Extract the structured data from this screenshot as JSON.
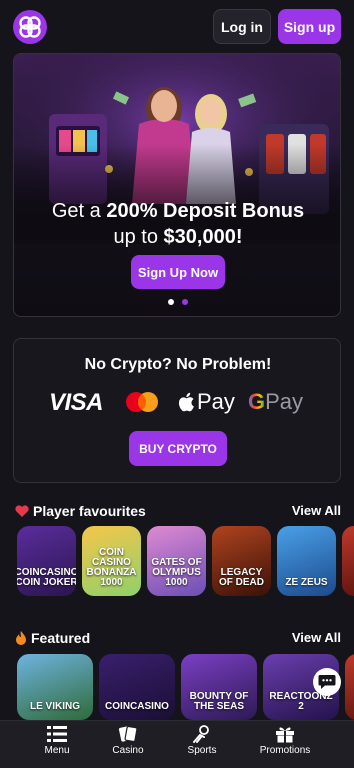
{
  "header": {
    "logo_icon": "coincasino-logo-icon",
    "login_label": "Log in",
    "signup_label": "Sign up"
  },
  "hero": {
    "title_prefix": "Get a ",
    "title_bold": "200% Deposit Bonus",
    "sub_prefix": "up to ",
    "sub_bold": "$30,000!",
    "cta_label": "Sign Up Now",
    "slides": 2,
    "active_slide": 1
  },
  "crypto": {
    "title": "No Crypto? No Problem!",
    "methods": [
      "VISA",
      "Mastercard",
      "Apple Pay",
      "Google Pay"
    ],
    "visa_text": "VISA",
    "applepay_text": "Pay",
    "gpay_g": "G",
    "gpay_text": "Pay",
    "buy_label": "BUY CRYPTO"
  },
  "favourites": {
    "title": "Player favourites",
    "icon": "heart-icon",
    "view_all": "View All",
    "games": [
      {
        "label": "COINCASINO COIN JOKER",
        "colors": [
          "#5a2d9c",
          "#2a1650"
        ]
      },
      {
        "label": "COIN CASINO BONANZA 1000",
        "colors": [
          "#f5c64a",
          "#8fd06a"
        ]
      },
      {
        "label": "GATES OF OLYMPUS 1000",
        "colors": [
          "#e08ad2",
          "#6a4fb5"
        ]
      },
      {
        "label": "LEGACY OF DEAD",
        "colors": [
          "#b0431f",
          "#3a1208"
        ]
      },
      {
        "label": "ZE ZEUS",
        "colors": [
          "#4aa0e8",
          "#1c4a8c"
        ]
      },
      {
        "label": "",
        "colors": [
          "#c0392b",
          "#4a0e0a"
        ]
      }
    ]
  },
  "featured": {
    "title": "Featured",
    "icon": "fire-icon",
    "view_all": "View All",
    "games": [
      {
        "label": "LE VIKING",
        "colors": [
          "#6fb3e0",
          "#2e6b3a"
        ]
      },
      {
        "label": "COINCASINO",
        "colors": [
          "#3a1f6e",
          "#1a0f33"
        ]
      },
      {
        "label": "BOUNTY OF THE SEAS",
        "colors": [
          "#7b3fc4",
          "#2d1a55"
        ]
      },
      {
        "label": "REACTOONZ 2",
        "colors": [
          "#6a3fb0",
          "#24124a"
        ]
      },
      {
        "label": "",
        "colors": [
          "#c0392b",
          "#4a0e0a"
        ]
      }
    ]
  },
  "chat": {
    "icon": "chat-bubble-icon"
  },
  "nav": {
    "items": [
      {
        "label": "Menu",
        "icon": "menu-icon"
      },
      {
        "label": "Casino",
        "icon": "cards-icon"
      },
      {
        "label": "Sports",
        "icon": "sports-icon"
      },
      {
        "label": "Promotions",
        "icon": "gift-icon"
      }
    ]
  },
  "colors": {
    "accent": "#9b35e8",
    "background": "#15141b"
  }
}
